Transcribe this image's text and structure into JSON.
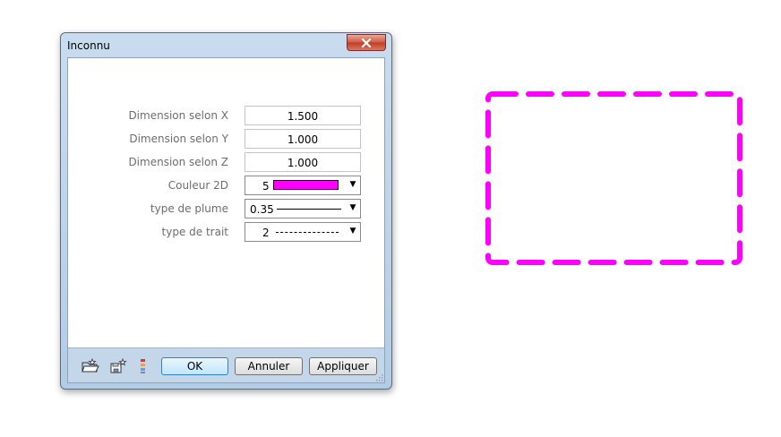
{
  "dialog": {
    "title": "Inconnu",
    "fields": [
      {
        "label": "Dimension selon X",
        "value": "1.500"
      },
      {
        "label": "Dimension selon Y",
        "value": "1.000"
      },
      {
        "label": "Dimension selon Z",
        "value": "1.000"
      }
    ],
    "color": {
      "label": "Couleur 2D",
      "value": "5",
      "swatch": "#ff00ff"
    },
    "pen": {
      "label": "type de plume",
      "value": "0.35"
    },
    "line": {
      "label": "type de trait",
      "value": "2"
    },
    "buttons": {
      "ok": "OK",
      "cancel": "Annuler",
      "apply": "Appliquer"
    }
  },
  "colors": {
    "accent": "#ff00ff",
    "footer": "#c4d6ea",
    "close": "#c8472f"
  },
  "icons": [
    "close-icon",
    "folder-open-icon",
    "favorite-save-icon",
    "layers-icon",
    "chevron-down-icon",
    "resize-grip-icon"
  ]
}
